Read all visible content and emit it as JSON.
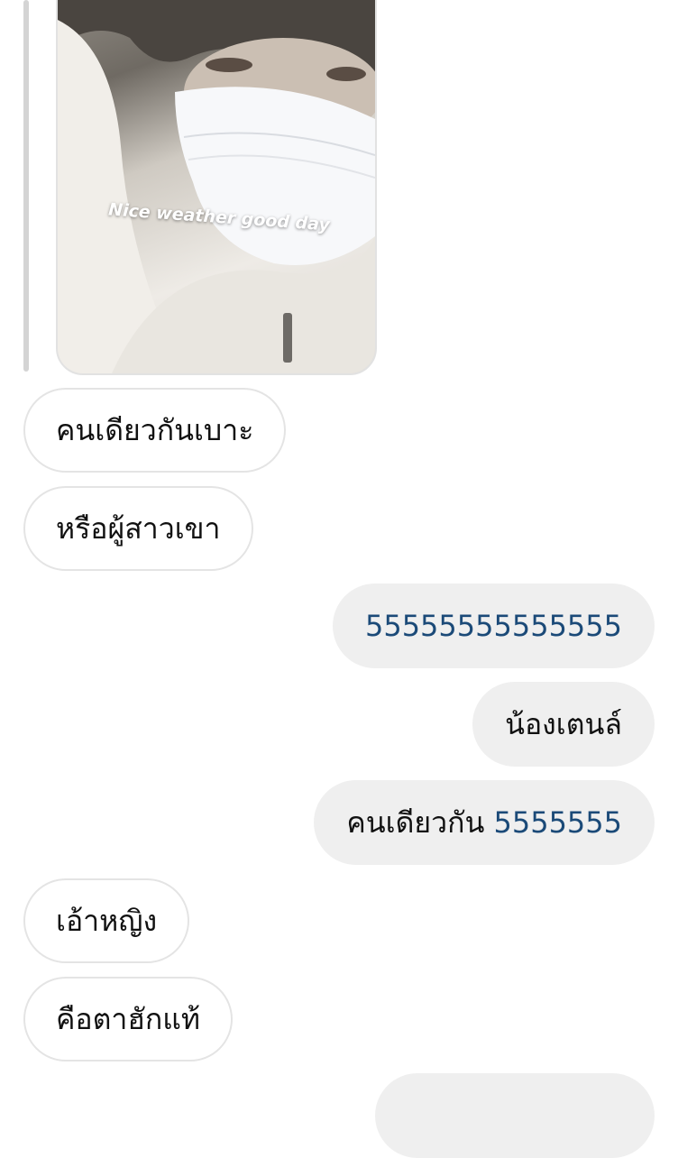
{
  "story": {
    "caption": "Nice weather good day"
  },
  "messages": [
    {
      "side": "in",
      "text": "คนเดียวกันเบาะ"
    },
    {
      "side": "in",
      "text": "หรือผู้สาวเขา"
    },
    {
      "side": "out",
      "text": "55555555555555"
    },
    {
      "side": "out",
      "text": "น้องเตนล์"
    },
    {
      "side": "out",
      "text": "คนเดียวกัน",
      "suffix": "5555555"
    },
    {
      "side": "in",
      "text": "เอ้าหญิง"
    },
    {
      "side": "in",
      "text": "คือตาฮักแท้"
    }
  ],
  "colors": {
    "incoming_bubble": "#ffffff",
    "outgoing_bubble": "#efefef",
    "link_number": "#1b4a78"
  }
}
